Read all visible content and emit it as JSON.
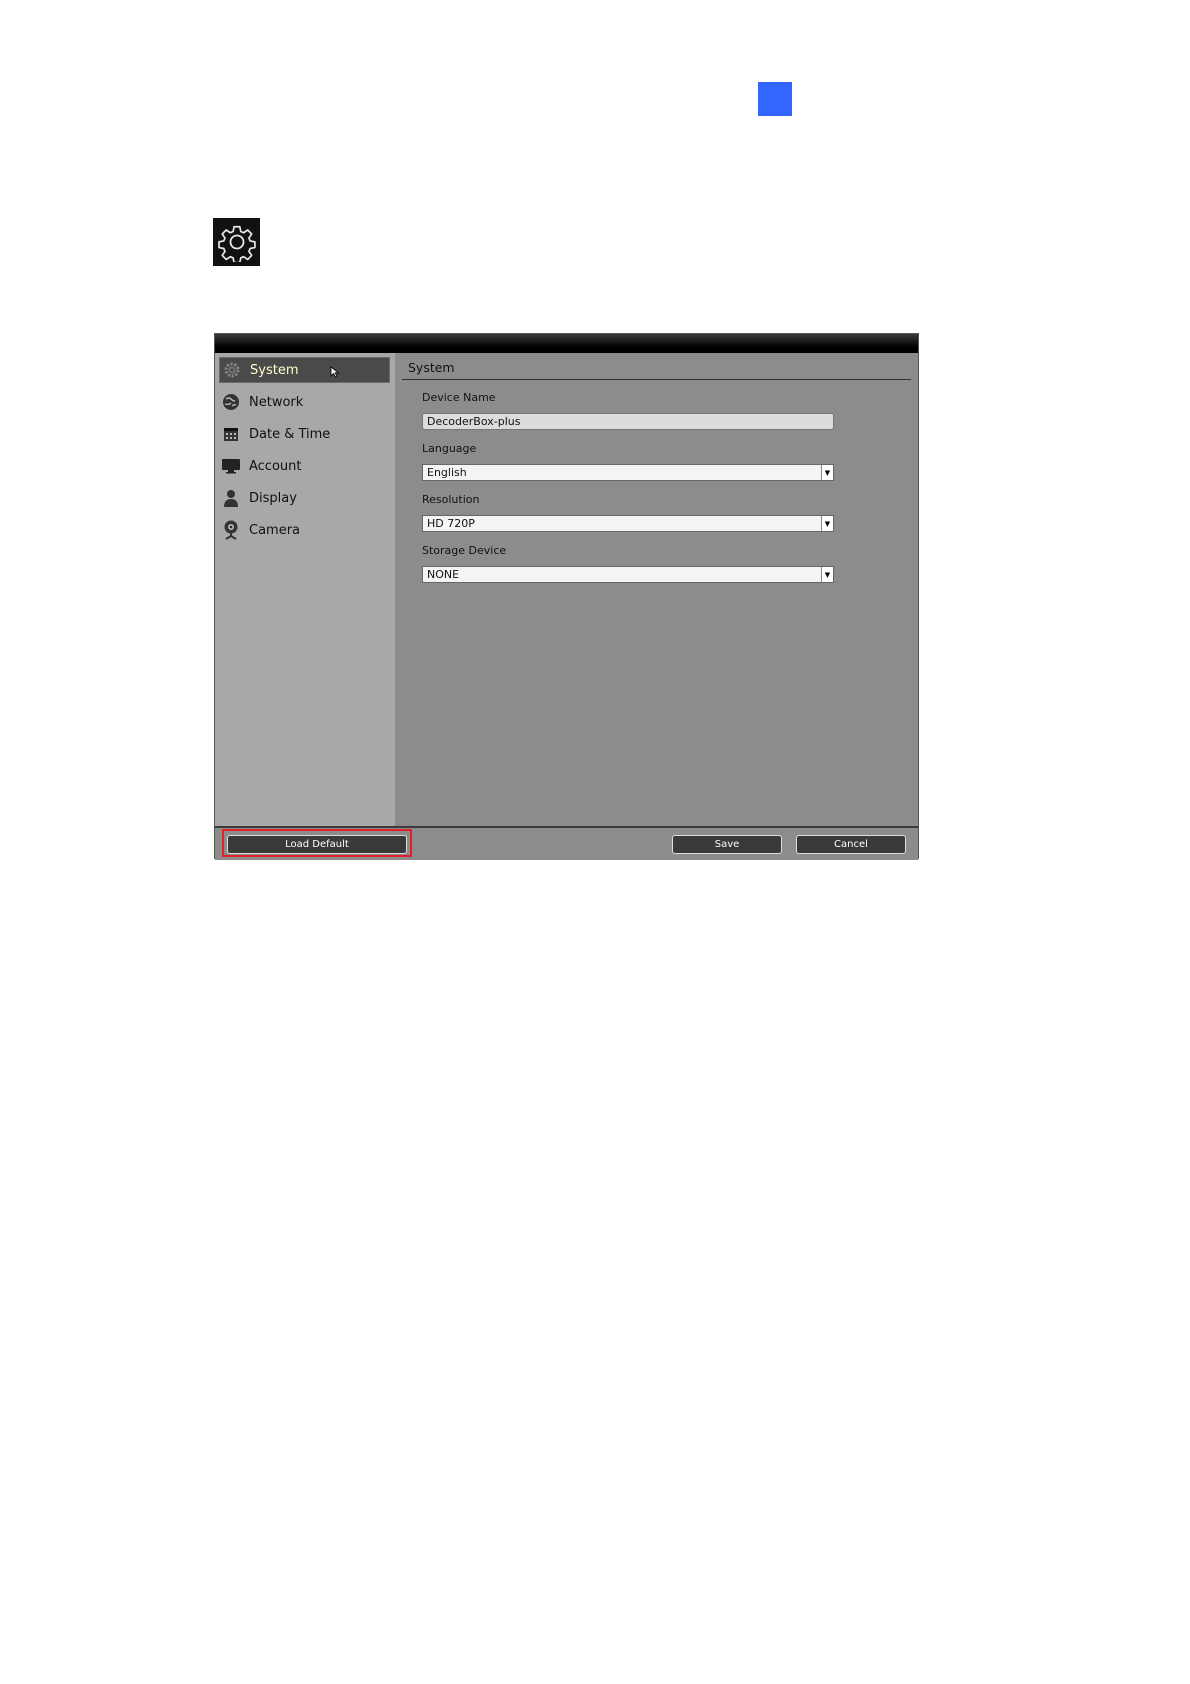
{
  "sidebar": {
    "items": [
      {
        "label": "System",
        "icon": "gear-icon",
        "active": true
      },
      {
        "label": "Network",
        "icon": "globe-icon"
      },
      {
        "label": "Date & Time",
        "icon": "calendar-icon"
      },
      {
        "label": "Account",
        "icon": "monitor-icon"
      },
      {
        "label": "Display",
        "icon": "person-icon"
      },
      {
        "label": "Camera",
        "icon": "webcam-icon"
      }
    ]
  },
  "content": {
    "title": "System",
    "device_name": {
      "label": "Device Name",
      "value": "DecoderBox-plus"
    },
    "language": {
      "label": "Language",
      "value": "English"
    },
    "resolution": {
      "label": "Resolution",
      "value": "HD 720P"
    },
    "storage": {
      "label": "Storage Device",
      "value": "NONE"
    }
  },
  "footer": {
    "load_default": "Load Default",
    "save": "Save",
    "cancel": "Cancel"
  },
  "colors": {
    "accent_square": "#3366ff",
    "highlight": "#e0202a"
  }
}
